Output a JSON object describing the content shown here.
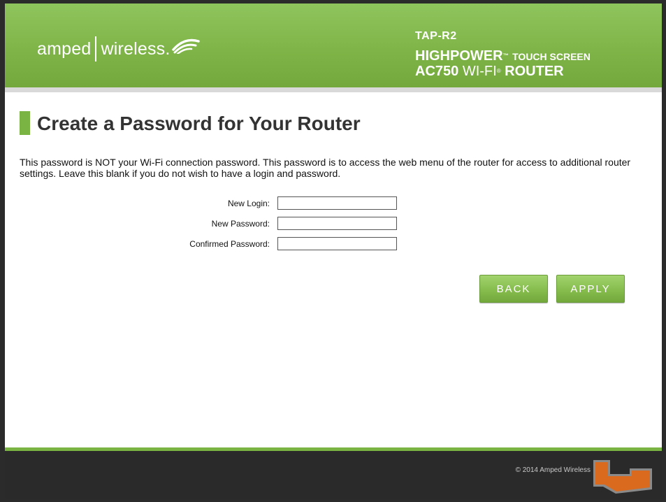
{
  "header": {
    "brand_left": "amped",
    "brand_right": "wireless.",
    "model": "TAP-R2",
    "line1_main": "HIGHPOWER",
    "line1_tm": "™",
    "line1_sub": "TOUCH SCREEN",
    "line2_main": "AC750",
    "line2_thin": "WI-FI",
    "line2_tm": "®",
    "line2_end": "ROUTER"
  },
  "main": {
    "title": "Create a Password for Your Router",
    "description": "This password is NOT your Wi-Fi connection password. This password is to access the web menu of the router for access to additional router settings. Leave this blank if you do not wish to have a login and password.",
    "fields": [
      {
        "label": "New Login:",
        "value": ""
      },
      {
        "label": "New Password:",
        "value": ""
      },
      {
        "label": "Confirmed Password:",
        "value": ""
      }
    ],
    "back_label": "BACK",
    "apply_label": "APPLY"
  },
  "footer": {
    "copyright": "© 2014 Amped Wireless"
  },
  "colors": {
    "brand_green": "#7ab543",
    "footer_bg": "#2a2a2a"
  }
}
